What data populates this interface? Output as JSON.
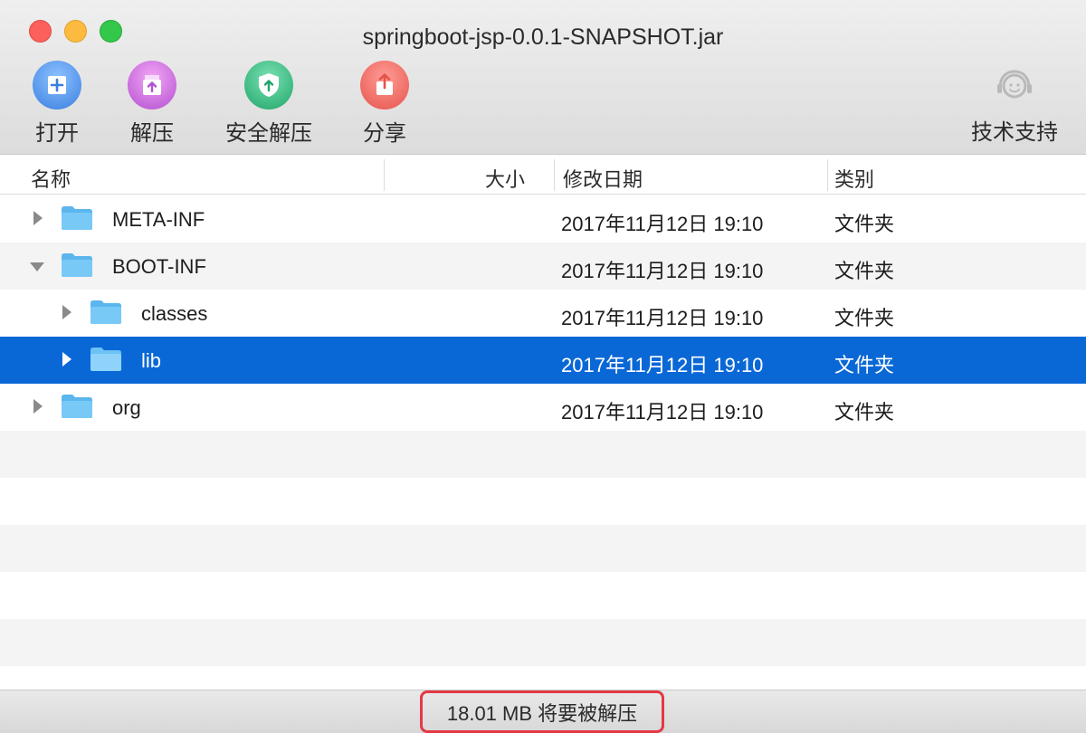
{
  "window": {
    "title": "springboot-jsp-0.0.1-SNAPSHOT.jar"
  },
  "toolbar": {
    "open_label": "打开",
    "extract_label": "解压",
    "secure_extract_label": "安全解压",
    "share_label": "分享",
    "support_label": "技术支持"
  },
  "columns": {
    "name": "名称",
    "size": "大小",
    "modified": "修改日期",
    "kind": "类别"
  },
  "rows": [
    {
      "name": "META-INF",
      "modified": "2017年11月12日 19:10",
      "kind": "文件夹",
      "level": 0,
      "expanded": false,
      "selected": false
    },
    {
      "name": "BOOT-INF",
      "modified": "2017年11月12日 19:10",
      "kind": "文件夹",
      "level": 0,
      "expanded": true,
      "selected": false
    },
    {
      "name": "classes",
      "modified": "2017年11月12日 19:10",
      "kind": "文件夹",
      "level": 1,
      "expanded": false,
      "selected": false
    },
    {
      "name": "lib",
      "modified": "2017年11月12日 19:10",
      "kind": "文件夹",
      "level": 1,
      "expanded": false,
      "selected": true
    },
    {
      "name": "org",
      "modified": "2017年11月12日 19:10",
      "kind": "文件夹",
      "level": 0,
      "expanded": false,
      "selected": false
    }
  ],
  "status": {
    "text": "18.01 MB 将要被解压"
  },
  "colors": {
    "selection": "#0a68d6",
    "folder": "#6cc2f5",
    "status_highlight": "#e33a45"
  }
}
